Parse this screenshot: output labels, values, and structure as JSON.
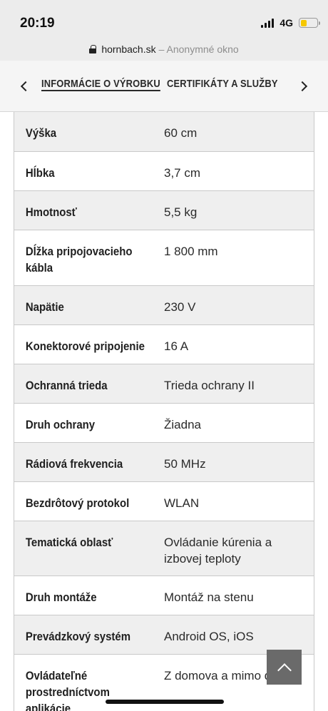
{
  "status_bar": {
    "time": "20:19",
    "network": "4G",
    "battery_level": 0.35,
    "battery_color": "#f6c800"
  },
  "browser": {
    "domain": "hornbach.sk",
    "mode": "– Anonymné okno",
    "icons": [
      "lock-icon"
    ]
  },
  "tabs": {
    "items": [
      {
        "label": "INFORMÁCIE O VÝROBKU",
        "active": true
      },
      {
        "label": "CERTIFIKÁTY A SLUŽBY",
        "active": false
      }
    ],
    "icons": [
      "chevron-left-icon",
      "chevron-right-icon"
    ]
  },
  "specs": [
    {
      "label": "Výška",
      "value": "60 cm"
    },
    {
      "label": "Hĺbka",
      "value": "3,7 cm"
    },
    {
      "label": "Hmotnosť",
      "value": "5,5 kg"
    },
    {
      "label": "Dĺžka pripojovacieho kábla",
      "value": "1 800 mm"
    },
    {
      "label": "Napätie",
      "value": "230 V"
    },
    {
      "label": "Konektorové pripojenie",
      "value": "16 A"
    },
    {
      "label": "Ochranná trieda",
      "value": "Trieda ochrany II"
    },
    {
      "label": "Druh ochrany",
      "value": "Žiadna"
    },
    {
      "label": "Rádiová frekvencia",
      "value": "50 MHz"
    },
    {
      "label": "Bezdrôtový protokol",
      "value": "WLAN"
    },
    {
      "label": "Tematická oblasť",
      "value": "Ovládanie kúrenia a izbovej teploty"
    },
    {
      "label": "Druh montáže",
      "value": "Montáž na stenu"
    },
    {
      "label": "Prevádzkový systém",
      "value": "Android OS, iOS"
    },
    {
      "label": "Ovládateľné prostredníctvom aplikácie",
      "value": "Z domova a mimo domov"
    }
  ],
  "colors": {
    "row_shade": "#efefef",
    "border": "#c9c9c9",
    "scroll_button": "#6a6a6a"
  }
}
